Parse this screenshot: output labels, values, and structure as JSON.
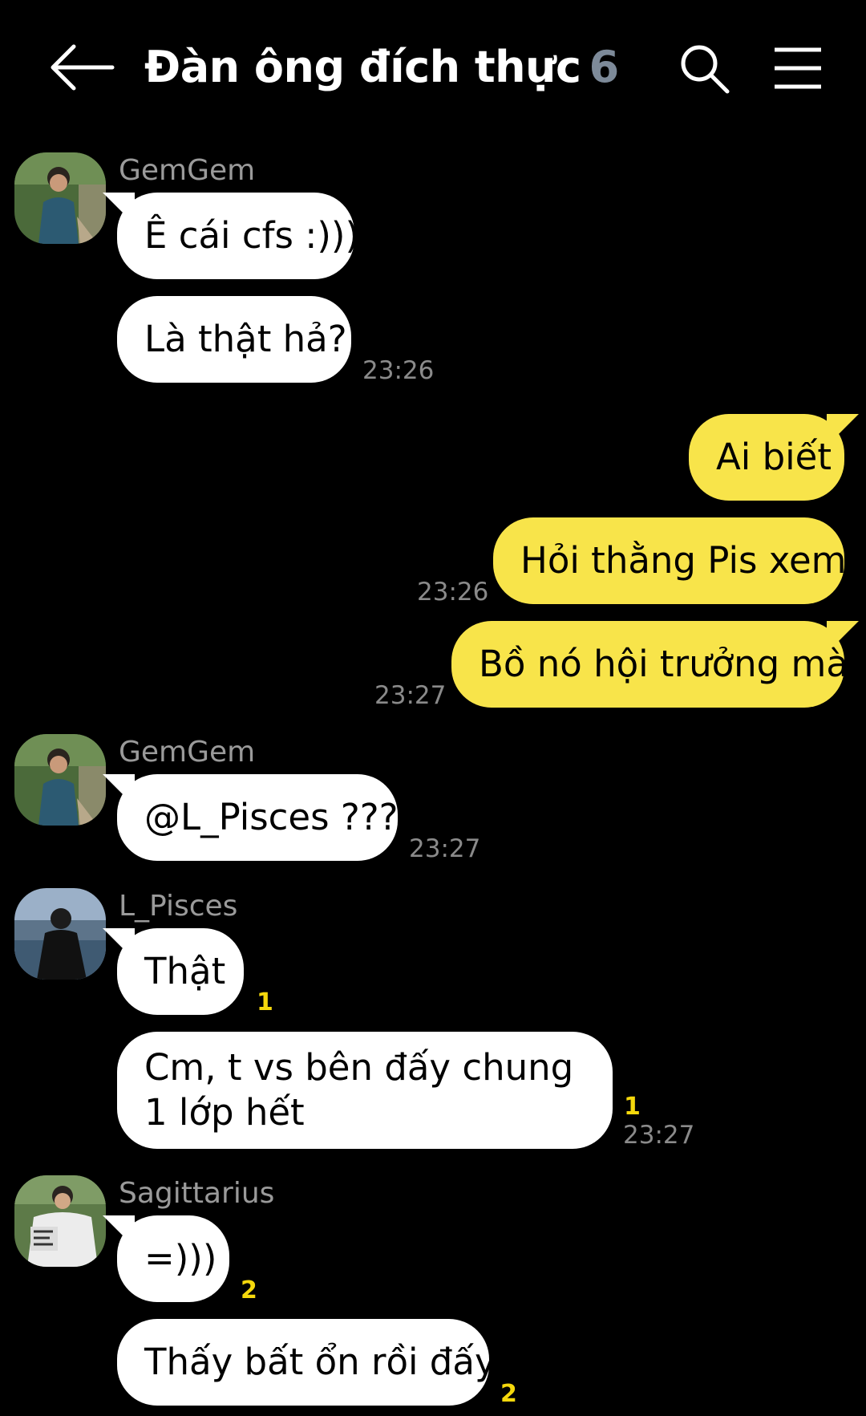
{
  "header": {
    "title": "Đàn ông đích thực",
    "member_count": "6"
  },
  "messages": [
    {
      "sender": "GemGem",
      "text": "Ê cái cfs :)))"
    },
    {
      "text": "Là thật hả?",
      "time": "23:26"
    },
    {
      "text": "Ai biết"
    },
    {
      "text": "Hỏi thằng Pis xem",
      "time": "23:26"
    },
    {
      "text": "Bồ nó hội trưởng mà",
      "time": "23:27"
    },
    {
      "sender": "GemGem",
      "text": "@L_Pisces ???",
      "time": "23:27"
    },
    {
      "sender": "L_Pisces",
      "text": "Thật",
      "unread": "1"
    },
    {
      "text": "Cm, t vs bên đấy chung 1 lớp hết",
      "unread": "1",
      "time": "23:27"
    },
    {
      "sender": "Sagittarius",
      "text": "=)))",
      "unread": "2"
    },
    {
      "text": "Thấy bất ổn rồi đấy",
      "unread": "2"
    }
  ],
  "colors": {
    "background": "#000000",
    "incoming_bubble": "#ffffff",
    "outgoing_bubble": "#f8e44a",
    "unread": "#f5d80c"
  }
}
